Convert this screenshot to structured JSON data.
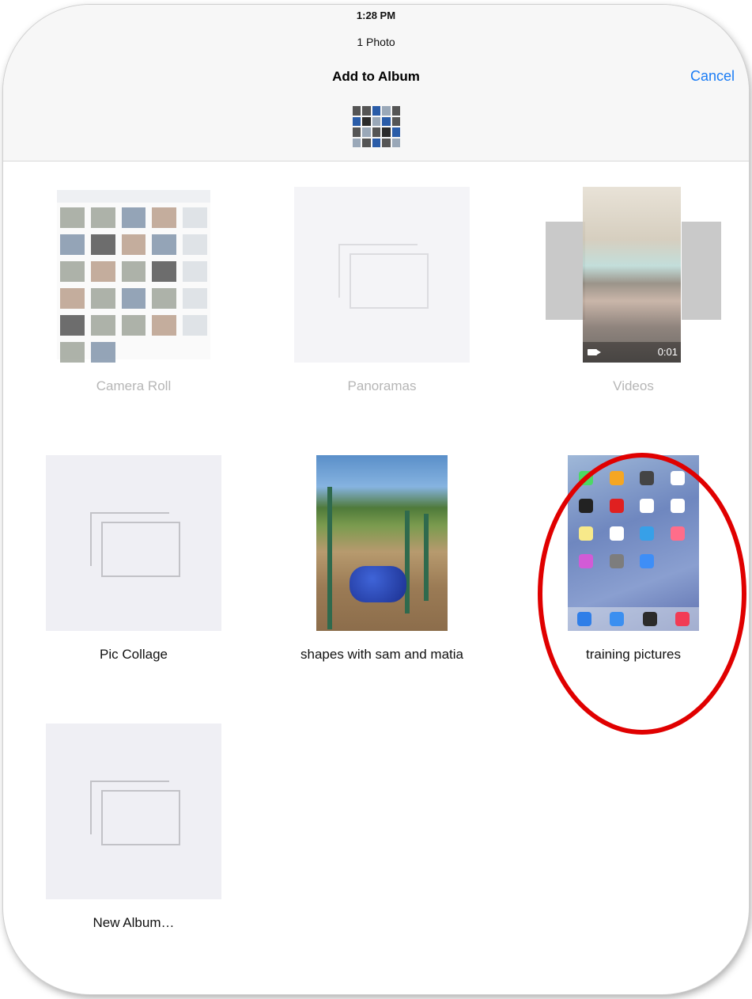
{
  "status_bar": {
    "time": "1:28 PM"
  },
  "header": {
    "selection_count": "1 Photo",
    "title": "Add to Album",
    "cancel_label": "Cancel"
  },
  "albums": [
    {
      "label": "Camera Roll",
      "cover": "photo-grid",
      "enabled": false
    },
    {
      "label": "Panoramas",
      "cover": "placeholder",
      "enabled": false
    },
    {
      "label": "Videos",
      "cover": "video-stack",
      "enabled": false,
      "duration": "0:01"
    },
    {
      "label": "Pic Collage",
      "cover": "placeholder",
      "enabled": true
    },
    {
      "label": "shapes with sam and matia",
      "cover": "playground-photo",
      "enabled": true
    },
    {
      "label": "training pictures",
      "cover": "ipad-homescreen",
      "enabled": true,
      "highlighted": true
    },
    {
      "label": "New Album…",
      "cover": "placeholder",
      "enabled": true
    }
  ],
  "annotation": {
    "color": "#e00000",
    "shape": "ellipse",
    "target": "training pictures"
  },
  "colors": {
    "accent": "#1a7cf5",
    "disabled_text": "#b6b6b6",
    "placeholder_bg": "#efeff4"
  }
}
